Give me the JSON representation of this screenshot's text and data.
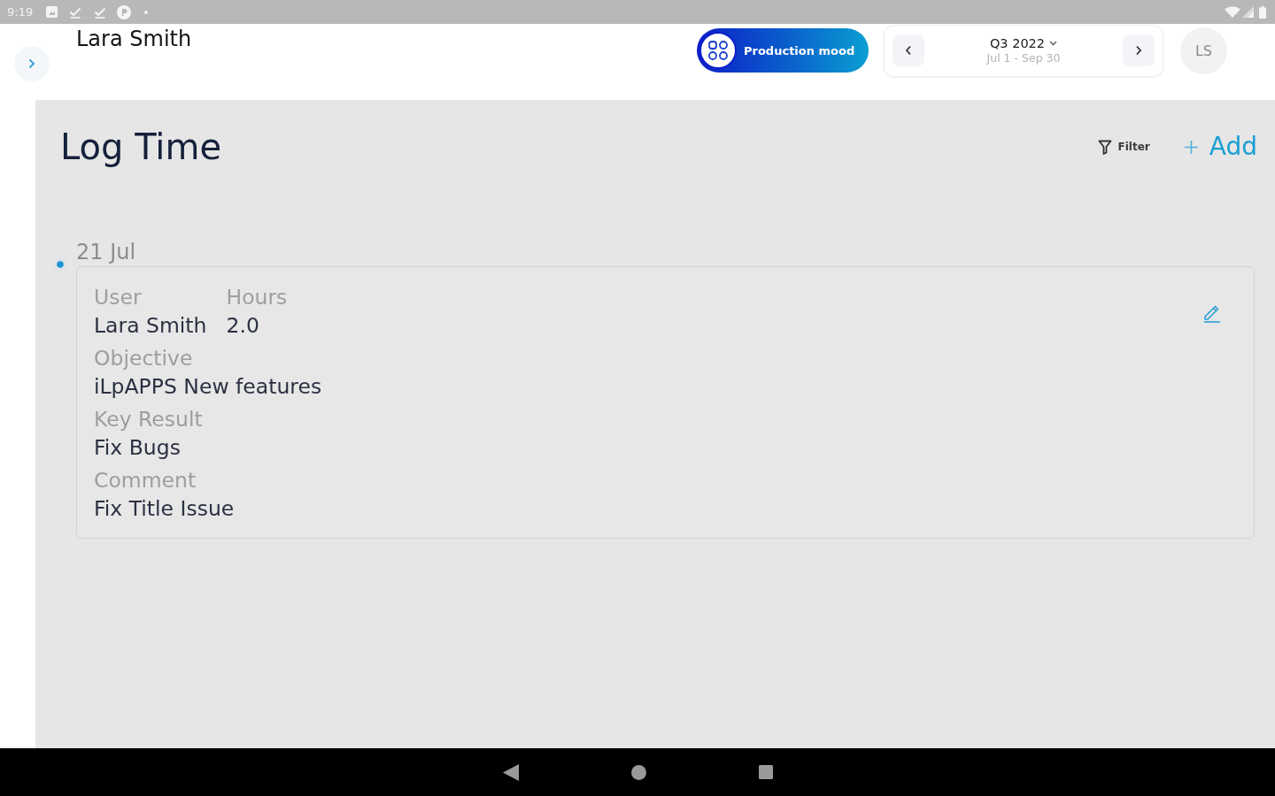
{
  "status_bar": {
    "time": "9:19"
  },
  "header": {
    "user_name": "Lara Smith",
    "mode_badge": "Production mood",
    "period": {
      "label": "Q3 2022",
      "range": "Jul 1 - Sep 30"
    },
    "avatar_initials": "LS"
  },
  "page": {
    "title": "Log Time",
    "actions": [
      {
        "kind": "filter",
        "label": "Filter"
      },
      {
        "kind": "add",
        "label": "Add"
      }
    ]
  },
  "entries": [
    {
      "date": "21 Jul",
      "rows": [
        [
          {
            "label": "User",
            "value": "Lara Smith"
          },
          {
            "label": "Hours",
            "value": "2.0"
          }
        ],
        [
          {
            "label": "Objective",
            "value": "iLpAPPS New features"
          }
        ],
        [
          {
            "label": "Key Result",
            "value": "Fix Bugs"
          }
        ],
        [
          {
            "label": "Comment",
            "value": "Fix Title Issue"
          }
        ]
      ]
    }
  ]
}
